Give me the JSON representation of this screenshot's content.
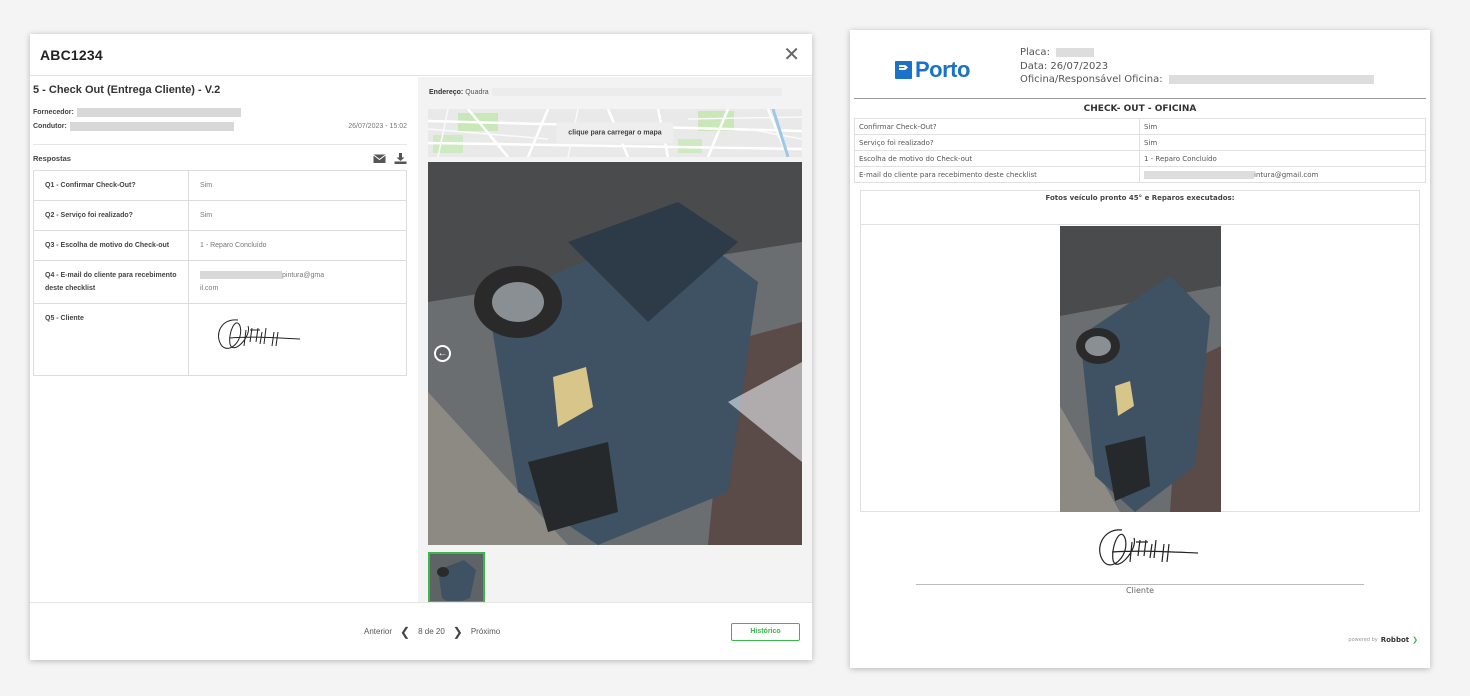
{
  "modal": {
    "title": "ABC1234",
    "close_glyph": "✕",
    "form_title": "5 - Check Out (Entrega Cliente) - V.2",
    "supplier_label": "Fornecedor:",
    "driver_label": "Condutor:",
    "date": "26/07/2023 - 15:02",
    "answers_label": "Respostas",
    "answers": [
      {
        "question": "Q1 - Confirmar Check-Out?",
        "answer": "Sim"
      },
      {
        "question": "Q2 - Serviço foi realizado?",
        "answer": "Sim"
      },
      {
        "question": "Q3 - Escolha de motivo do Check-out",
        "answer": "1 - Reparo Concluído"
      },
      {
        "question": "Q4 - E-mail do cliente para recebimento deste checklist",
        "answer_suffix": "pintura@gma",
        "answer_line2": "il.com"
      },
      {
        "question": "Q5 - Cliente",
        "answer": ""
      }
    ],
    "address_label": "Endereço:",
    "address_value": "Quadra",
    "map_button": "clique para carregar o mapa",
    "pager": {
      "prev": "Anterior",
      "prev_glyph": "❮",
      "position": "8 de 20",
      "next_glyph": "❯",
      "next": "Próximo"
    },
    "history_button": "Histórico"
  },
  "report": {
    "logo_text": "Porto",
    "plate_label": "Placa:",
    "date_line": "Data: 26/07/2023",
    "workshop_label": "Oficina/Responsável Oficina:",
    "heading": "CHECK- OUT - OFICINA",
    "rows": [
      {
        "q": "Confirmar Check-Out?",
        "a": "Sim"
      },
      {
        "q": "Serviço foi realizado?",
        "a": "Sim"
      },
      {
        "q": "Escolha de motivo do Check-out",
        "a": "1 - Reparo Concluído"
      },
      {
        "q": "E-mail do cliente para recebimento deste checklist",
        "a_suffix": "intura@gmail.com"
      }
    ],
    "photos_title": "Fotos veículo pronto 45° e Reparos executados:",
    "signature_label": "Cliente",
    "powered_by": "powered by",
    "powered_brand": "Robbot"
  },
  "colors": {
    "accent_green": "#3cb54a",
    "porto_blue": "#1a73c9"
  }
}
